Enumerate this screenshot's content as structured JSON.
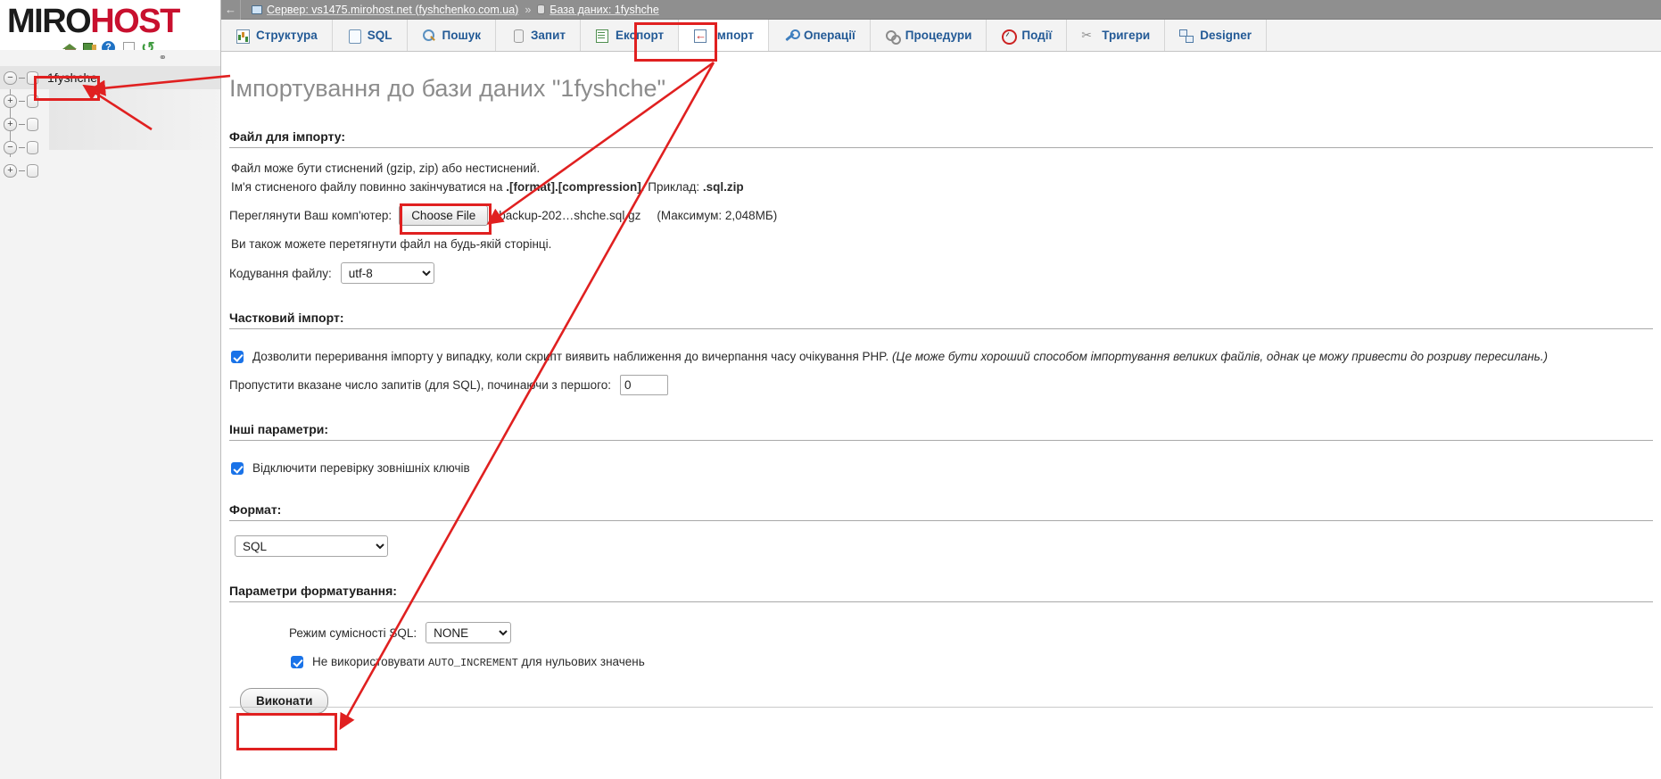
{
  "brand": {
    "name_part1": "MIRO",
    "name_part2": "HOST",
    "icons": [
      "home-icon",
      "exit-icon",
      "help-icon",
      "doc-icon",
      "refresh-icon"
    ]
  },
  "topbar": {
    "back_arrow": "←",
    "server_label": "Сервер: vs1475.mirohost.net (fyshchenko.com.ua)",
    "separator": "»",
    "database_label": "База даних: 1fyshche"
  },
  "tabs": [
    {
      "label": "Структура",
      "icon": "structure-icon",
      "active": false
    },
    {
      "label": "SQL",
      "icon": "sql-icon",
      "active": false
    },
    {
      "label": "Пошук",
      "icon": "search-icon",
      "active": false
    },
    {
      "label": "Запит",
      "icon": "query-icon",
      "active": false
    },
    {
      "label": "Експорт",
      "icon": "export-icon",
      "active": false
    },
    {
      "label": "Імпорт",
      "icon": "import-icon",
      "active": true
    },
    {
      "label": "Операції",
      "icon": "operations-icon",
      "active": false
    },
    {
      "label": "Процедури",
      "icon": "procedures-icon",
      "active": false
    },
    {
      "label": "Події",
      "icon": "events-icon",
      "active": false
    },
    {
      "label": "Тригери",
      "icon": "triggers-icon",
      "active": false
    },
    {
      "label": "Designer",
      "icon": "designer-icon",
      "active": false
    }
  ],
  "sidebar": {
    "tree": [
      {
        "toggle": "−",
        "label": "1fyshche",
        "selected": true
      },
      {
        "toggle": "+",
        "label": "",
        "selected": false
      },
      {
        "toggle": "+",
        "label": "",
        "selected": false
      },
      {
        "toggle": "−",
        "label": "",
        "selected": false
      },
      {
        "toggle": "+",
        "label": "",
        "selected": false
      }
    ]
  },
  "main": {
    "page_title": "Імпортування до бази даних \"1fyshche\"",
    "file_section": {
      "legend": "Файл для імпорту:",
      "hint1": "Файл може бути стиснений (gzip, zip) або нестиснений.",
      "hint2_pre": "Ім'я стисненого файлу повинно закінчуватися на ",
      "hint2_bold": ".[format].[compression]",
      "hint2_mid": ". Приклад: ",
      "hint2_bold2": ".sql.zip",
      "browse_label": "Переглянути Ваш комп'ютер:",
      "choose_file_button": "Choose File",
      "chosen_file": "backup-202…shche.sql.gz",
      "max_size": "(Максимум: 2,048МБ)",
      "drag_hint": "Ви також можете перетягнути файл на будь-якій сторінці.",
      "encoding_label": "Кодування файлу:",
      "encoding_value": "utf-8"
    },
    "partial_section": {
      "legend": "Частковий імпорт:",
      "allow_interrupt_pre": "Дозволити переривання імпорту у випадку, коли скрипт виявить наближення до вичерпання часу очікування PHP. ",
      "allow_interrupt_italic": "(Це може бути хороший способом імпортування великих файлів, однак це можу привести до розриву пересилань.)",
      "allow_interrupt_checked": true,
      "skip_label": "Пропустити вказане число запитів (для SQL), починаючи з першого:",
      "skip_value": "0"
    },
    "other_section": {
      "legend": "Інші параметри:",
      "disable_fk_label": "Відключити перевірку зовнішніх ключів",
      "disable_fk_checked": true
    },
    "format_section": {
      "legend": "Формат:",
      "format_value": "SQL"
    },
    "format_options_section": {
      "legend": "Параметри форматування:",
      "compat_label": "Режим сумісності SQL:",
      "compat_value": "NONE",
      "no_autoincrement_pre": "Не використовувати ",
      "no_autoincrement_mono": "AUTO_INCREMENT",
      "no_autoincrement_post": " для нульових значень",
      "no_autoincrement_checked": true
    },
    "submit_button": "Виконати"
  },
  "annotations": {
    "highlight_color": "#e02020",
    "boxes": [
      "database-tree-item",
      "import-tab",
      "choose-file-button",
      "execute-button"
    ],
    "arrows": [
      "tree-to-title-arrow",
      "import-tab-to-file-arrow",
      "import-tab-to-execute-arrow",
      "tree-pointer-arrow"
    ]
  }
}
